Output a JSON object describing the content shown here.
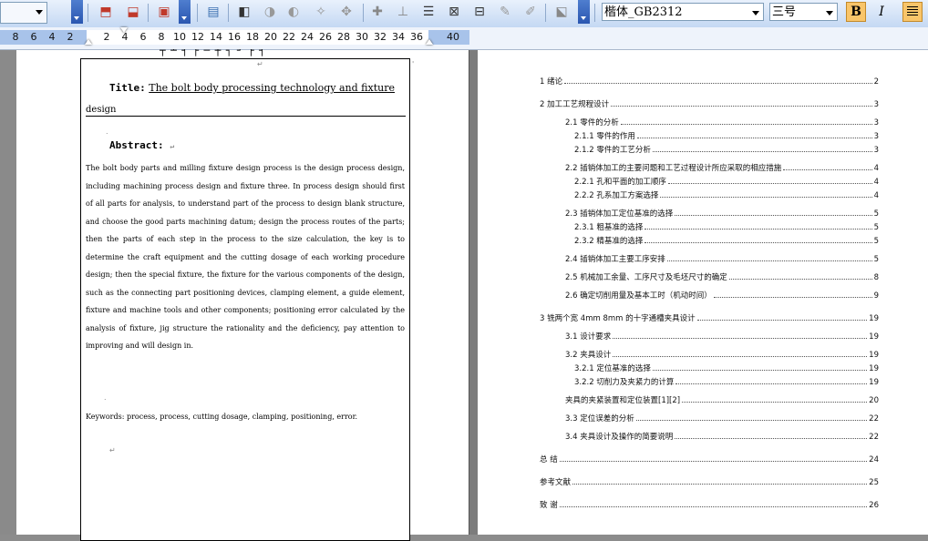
{
  "toolbar": {
    "font_name": "楷体_GB2312",
    "font_size": "三号",
    "bold_label": "B",
    "italic_label": "I"
  },
  "ruler": {
    "numbers": [
      "8",
      "6",
      "4",
      "2",
      "2",
      "4",
      "6",
      "8",
      "10",
      "12",
      "14",
      "16",
      "18",
      "20",
      "22",
      "24",
      "26",
      "28",
      "30",
      "32",
      "34",
      "36",
      "40"
    ]
  },
  "left_page": {
    "title_label": "Title:",
    "title_value": "The bolt body processing technology and fixture",
    "title_continued": "design",
    "abstract_label": "Abstract:",
    "abstract_body": "The bolt body parts and milling fixture design process is the design process design, including machining process design and fixture three. In process design should first of all parts for analysis, to understand part of the process to design blank structure, and choose the good parts machining datum; design the process routes of the parts; then the parts of each step in the process to the size calculation, the key is to determine the craft equipment and the cutting dosage of each working procedure design; then the special fixture, the fixture for the various components of the design, such as the connecting part positioning devices, clamping element, a guide element, fixture and machine tools and other components; positioning error calculated by the analysis of fixture, jig structure the rationality and the deficiency, pay attention to improving and will design in.",
    "keywords": "Keywords: process, process, cutting dosage, clamping, positioning, error."
  },
  "toc": [
    {
      "text": "1  绪论",
      "page": "2"
    },
    {
      "text": "2  加工工艺规程设计",
      "page": "3"
    },
    {
      "text": "2.1  零件的分析",
      "page": "3"
    },
    {
      "text": "2.1.1  零件的作用",
      "page": "3"
    },
    {
      "text": "2.1.2  零件的工艺分析",
      "page": "3"
    },
    {
      "text": "2.2  插销体加工的主要问题和工艺过程设计所应采取的相应措施",
      "page": "4"
    },
    {
      "text": "2.2.1  孔和平面的加工顺序",
      "page": "4"
    },
    {
      "text": "2.2.2  孔系加工方案选择",
      "page": "4"
    },
    {
      "text": "2.3  插销体加工定位基准的选择",
      "page": "5"
    },
    {
      "text": "2.3.1  粗基准的选择",
      "page": "5"
    },
    {
      "text": "2.3.2  精基准的选择",
      "page": "5"
    },
    {
      "text": "2.4  插销体加工主要工序安排",
      "page": "5"
    },
    {
      "text": "2.5  机械加工余量、工序尺寸及毛坯尺寸的确定",
      "page": "8"
    },
    {
      "text": "2.6 确定切削用量及基本工时（机动时间）",
      "page": "9"
    },
    {
      "text": "3  铣两个宽 4mm 8mm 的十字通槽夹具设计",
      "page": "19"
    },
    {
      "text": "3.1 设计要求",
      "page": "19"
    },
    {
      "text": "3.2 夹具设计",
      "page": "19"
    },
    {
      "text": "3.2.1    定位基准的选择",
      "page": "19"
    },
    {
      "text": "3.2.2    切削力及夹紧力的计算",
      "page": "19"
    },
    {
      "text": "夹具的夹紧装置和定位装置[1][2]",
      "page": "20"
    },
    {
      "text": "3.3 定位误差的分析",
      "page": "22"
    },
    {
      "text": "3.4 夹具设计及操作的简要说明",
      "page": "22"
    },
    {
      "text": "总  结",
      "page": "24"
    },
    {
      "text": "参考文献",
      "page": "25"
    },
    {
      "text": "致  谢",
      "page": "26"
    }
  ]
}
